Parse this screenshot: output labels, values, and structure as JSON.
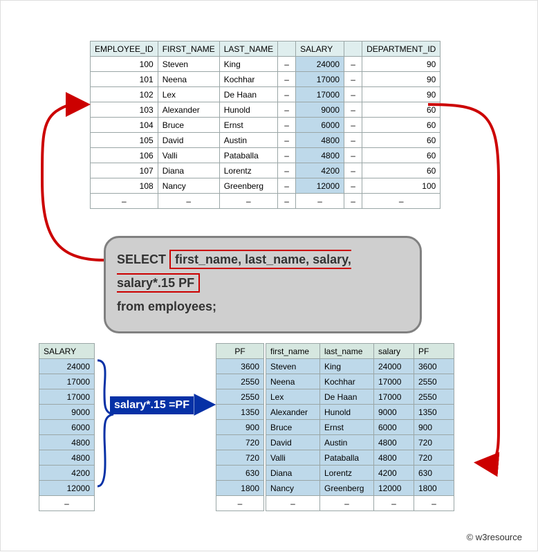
{
  "top": {
    "headers": [
      "EMPLOYEE_ID",
      "FIRST_NAME",
      "LAST_NAME",
      "SALARY",
      "DEPARTMENT_ID"
    ],
    "rows": [
      {
        "id": "100",
        "fn": "Steven",
        "ln": "King",
        "sal": "24000",
        "dept": "90"
      },
      {
        "id": "101",
        "fn": "Neena",
        "ln": "Kochhar",
        "sal": "17000",
        "dept": "90"
      },
      {
        "id": "102",
        "fn": "Lex",
        "ln": "De Haan",
        "sal": "17000",
        "dept": "90"
      },
      {
        "id": "103",
        "fn": "Alexander",
        "ln": "Hunold",
        "sal": "9000",
        "dept": "60"
      },
      {
        "id": "104",
        "fn": "Bruce",
        "ln": "Ernst",
        "sal": "6000",
        "dept": "60"
      },
      {
        "id": "105",
        "fn": "David",
        "ln": "Austin",
        "sal": "4800",
        "dept": "60"
      },
      {
        "id": "106",
        "fn": "Valli",
        "ln": "Pataballa",
        "sal": "4800",
        "dept": "60"
      },
      {
        "id": "107",
        "fn": "Diana",
        "ln": "Lorentz",
        "sal": "4200",
        "dept": "60"
      },
      {
        "id": "108",
        "fn": "Nancy",
        "ln": "Greenberg",
        "sal": "12000",
        "dept": "100"
      }
    ]
  },
  "query": {
    "select_kw": "SELECT",
    "cols": "first_name, last_name, salary, salary*.15 PF",
    "from": "from employees;"
  },
  "salary_header": "SALARY",
  "pf_header": "PF",
  "pf_label": "salary*.15 =PF",
  "salary_vals": [
    "24000",
    "17000",
    "17000",
    "9000",
    "6000",
    "4800",
    "4800",
    "4200",
    "12000"
  ],
  "pf_vals": [
    "3600",
    "2550",
    "2550",
    "1350",
    "900",
    "720",
    "720",
    "630",
    "1800"
  ],
  "result": {
    "headers": [
      "first_name",
      "last_name",
      "salary",
      "PF"
    ],
    "rows": [
      {
        "fn": "Steven",
        "ln": "King",
        "sal": "24000",
        "pf": "3600"
      },
      {
        "fn": "Neena",
        "ln": "Kochhar",
        "sal": "17000",
        "pf": "2550"
      },
      {
        "fn": "Lex",
        "ln": "De Haan",
        "sal": "17000",
        "pf": "2550"
      },
      {
        "fn": "Alexander",
        "ln": "Hunold",
        "sal": "9000",
        "pf": "1350"
      },
      {
        "fn": "Bruce",
        "ln": "Ernst",
        "sal": "6000",
        "pf": "900"
      },
      {
        "fn": "David",
        "ln": "Austin",
        "sal": "4800",
        "pf": "720"
      },
      {
        "fn": "Valli",
        "ln": "Pataballa",
        "sal": "4800",
        "pf": "720"
      },
      {
        "fn": "Diana",
        "ln": "Lorentz",
        "sal": "4200",
        "pf": "630"
      },
      {
        "fn": "Nancy",
        "ln": "Greenberg",
        "sal": "12000",
        "pf": "1800"
      }
    ]
  },
  "copyright": "© w3resource",
  "dash": "–"
}
